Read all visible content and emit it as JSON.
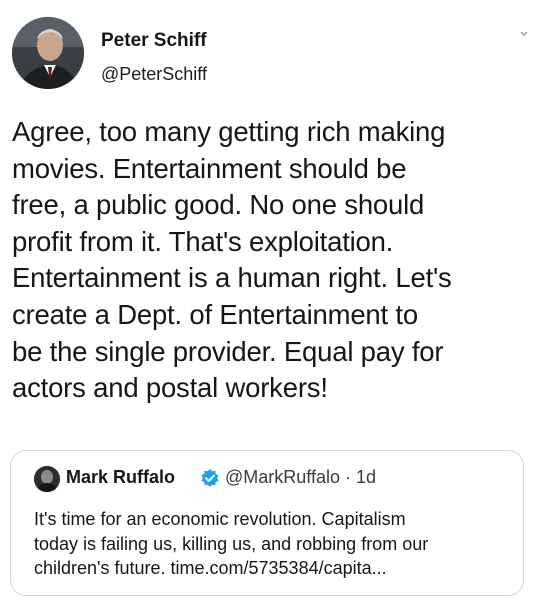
{
  "tweet": {
    "author": {
      "display_name": "Peter Schiff",
      "handle": "@PeterSchiff"
    },
    "text": "Agree, too many getting rich making\nmovies. Entertainment should be\nfree, a public good. No one should\nprofit from it. That's exploitation.\nEntertainment is a human right. Let's\ncreate a Dept. of Entertainment to\nbe the single provider. Equal pay for\nactors and postal workers!",
    "menu_icon": "chevron-down-icon"
  },
  "quoted_tweet": {
    "author": {
      "display_name": "Mark Ruffalo",
      "verified": true,
      "handle_and_time": "@MarkRuffalo · 1d"
    },
    "text": "It's time for an economic revolution. Capitalism\ntoday is failing us, killing us, and robbing from our\nchildren's future. time.com/5735384/capita...",
    "verified_color": "#1da1f2"
  }
}
